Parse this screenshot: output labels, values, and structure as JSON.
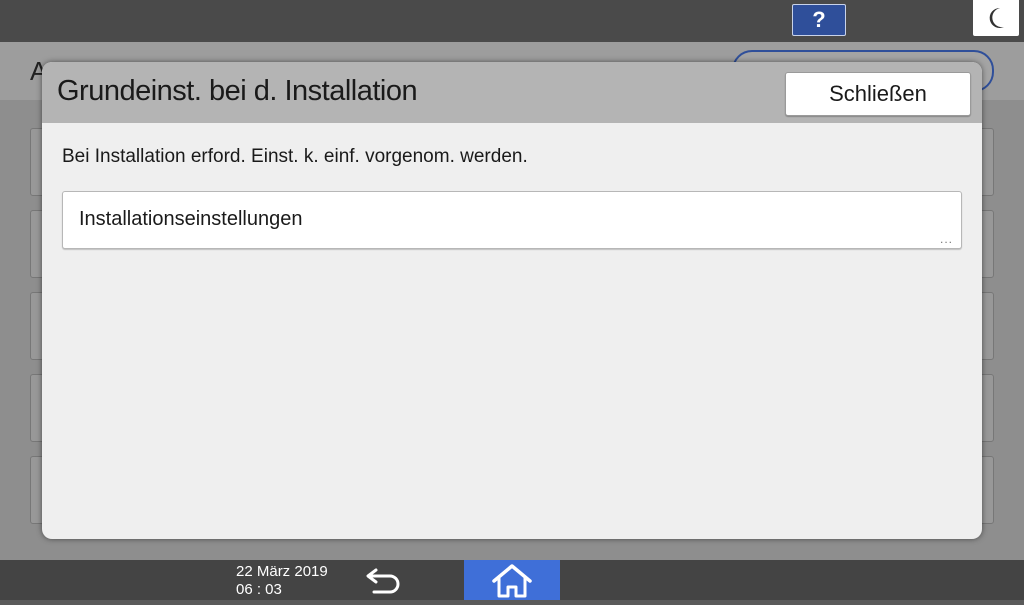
{
  "topbar": {
    "help_label": "?"
  },
  "background": {
    "title_partial": "A"
  },
  "dialog": {
    "title": "Grundeinst. bei d. Installation",
    "close_label": "Schließen",
    "description": "Bei Installation erford. Einst. k. einf. vorgenom. werden.",
    "items": [
      {
        "label": "Installationseinstellungen"
      }
    ],
    "more_indicator": "..."
  },
  "bottombar": {
    "date": "22 März 2019",
    "time": "06 : 03"
  },
  "icons": {
    "help": "question-icon",
    "sleep": "moon-icon",
    "back": "back-arrow-icon",
    "home": "home-icon"
  },
  "colors": {
    "accent": "#2f4f9a",
    "home": "#3f6fd8"
  }
}
